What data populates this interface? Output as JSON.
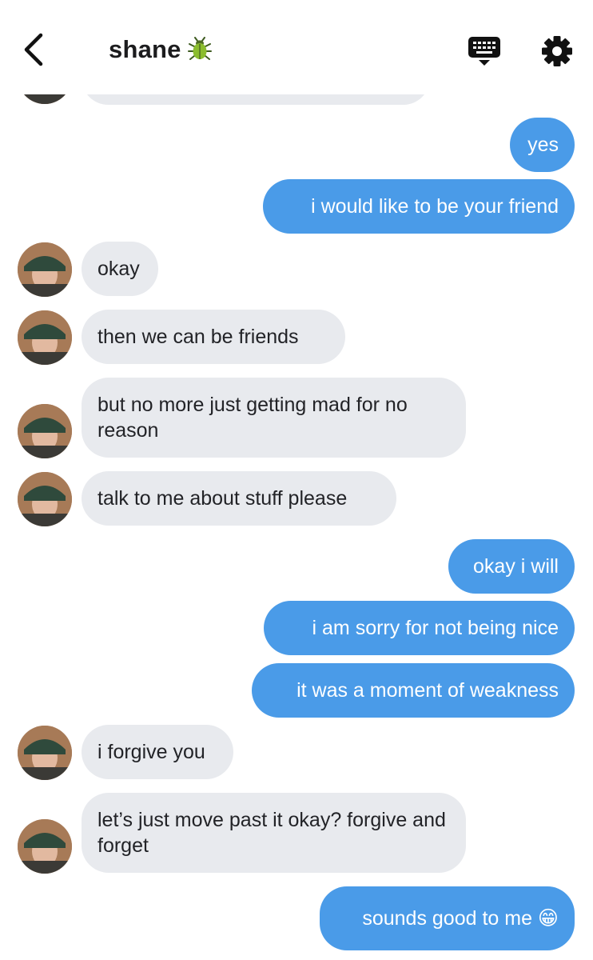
{
  "header": {
    "contact_name": "shane",
    "contact_emoji_icon": "beetle-icon",
    "back_icon": "chevron-left-icon",
    "keyboard_icon": "keyboard-icon",
    "settings_icon": "gear-icon"
  },
  "colors": {
    "outgoing_bubble": "#4a9be8",
    "incoming_bubble": "#e8eaee",
    "background": "#ffffff"
  },
  "messages": [
    {
      "from": "them",
      "text": ""
    },
    {
      "from": "me",
      "text": "yes"
    },
    {
      "from": "me",
      "text": "i would like to be your friend"
    },
    {
      "from": "them",
      "text": "okay"
    },
    {
      "from": "them",
      "text": "then we can be friends"
    },
    {
      "from": "them",
      "text": "but no more just getting mad for no reason"
    },
    {
      "from": "them",
      "text": "talk to me about stuff please"
    },
    {
      "from": "me",
      "text": "okay i will"
    },
    {
      "from": "me",
      "text": "i am sorry for not being nice"
    },
    {
      "from": "me",
      "text": "it was a moment of weakness"
    },
    {
      "from": "them",
      "text": "i forgive you"
    },
    {
      "from": "them",
      "text": "let’s just move past it okay? forgive and forget"
    },
    {
      "from": "me",
      "text": "sounds good to me 😁"
    }
  ]
}
